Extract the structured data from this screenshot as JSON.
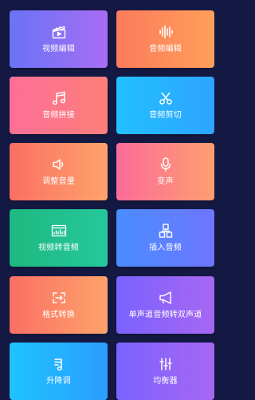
{
  "tools": [
    {
      "label": "视频编辑",
      "icon": "video-clapper-icon",
      "colors": [
        "#6a73f6",
        "#a86df4"
      ]
    },
    {
      "label": "音频编辑",
      "icon": "audio-waveform-icon",
      "colors": [
        "#fb7b5b",
        "#ff9f5a"
      ]
    },
    {
      "label": "音频拼接",
      "icon": "music-note-icon",
      "colors": [
        "#fd6f96",
        "#fd7f7a"
      ]
    },
    {
      "label": "音频剪切",
      "icon": "scissors-icon",
      "colors": [
        "#21c0ff",
        "#2ea4ff"
      ]
    },
    {
      "label": "调整音量",
      "icon": "speaker-volume-icon",
      "colors": [
        "#fb6f64",
        "#fda36b"
      ]
    },
    {
      "label": "变声",
      "icon": "microphone-icon",
      "colors": [
        "#fb6b9a",
        "#fe9e70"
      ]
    },
    {
      "label": "视频转音频",
      "icon": "video-to-audio-icon",
      "colors": [
        "#1db980",
        "#26c79c"
      ]
    },
    {
      "label": "插入音频",
      "icon": "insert-blocks-icon",
      "colors": [
        "#4a8dff",
        "#6d76ff"
      ]
    },
    {
      "label": "格式转换",
      "icon": "format-convert-icon",
      "colors": [
        "#fb6f64",
        "#fda36b"
      ]
    },
    {
      "label": "单声道音频转双声道",
      "icon": "megaphone-icon",
      "colors": [
        "#7a62ff",
        "#a767f2"
      ]
    },
    {
      "label": "升降调",
      "icon": "pitch-icon",
      "colors": [
        "#1fc3ff",
        "#2b9dff"
      ]
    },
    {
      "label": "均衡器",
      "icon": "equalizer-icon",
      "colors": [
        "#7a62ff",
        "#a767f2"
      ]
    }
  ]
}
